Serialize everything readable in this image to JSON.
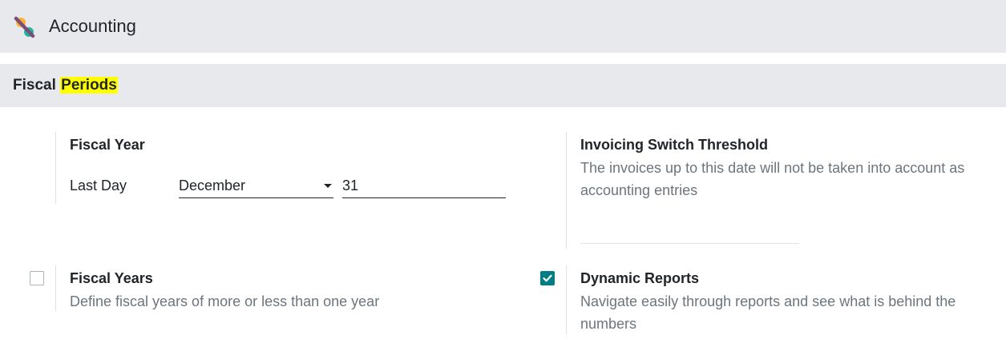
{
  "header": {
    "app_title": "Accounting",
    "logo_icon": "accounting-logo-icon"
  },
  "section": {
    "title_prefix": "Fiscal ",
    "title_highlight": "Periods"
  },
  "fiscal_year": {
    "title": "Fiscal Year",
    "last_day_label": "Last Day",
    "month_value": "December",
    "day_value": "31"
  },
  "invoicing_threshold": {
    "title": "Invoicing Switch Threshold",
    "description_line1": "The invoices up to this date will not be taken into account as",
    "description_line2": "accounting entries"
  },
  "fiscal_years": {
    "title": "Fiscal Years",
    "description": "Define fiscal years of more or less than one year",
    "checked": false
  },
  "dynamic_reports": {
    "title": "Dynamic Reports",
    "description_line1": "Navigate easily through reports and see what is behind the",
    "description_line2": "numbers",
    "checked": true
  },
  "colors": {
    "checkbox_checked": "#017e84",
    "highlight": "#ffff00",
    "header_bg": "#e7e9ed"
  }
}
